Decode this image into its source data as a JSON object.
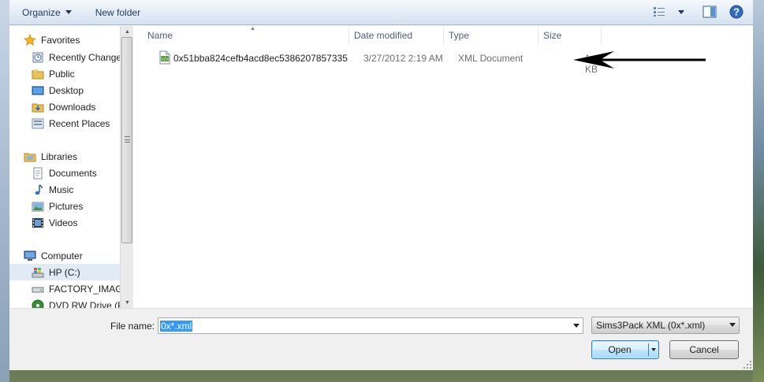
{
  "toolbar": {
    "organize_label": "Organize",
    "new_folder_label": "New folder",
    "icons": [
      "views-icon",
      "preview-pane-icon",
      "help-icon"
    ]
  },
  "nav": {
    "items": [
      {
        "label": "Favorites",
        "icon": "star-icon",
        "level": 1
      },
      {
        "label": "Recently Changed",
        "icon": "recent-icon",
        "level": 2
      },
      {
        "label": "Public",
        "icon": "folder-icon",
        "level": 2
      },
      {
        "label": "Desktop",
        "icon": "desktop-icon",
        "level": 2
      },
      {
        "label": "Downloads",
        "icon": "downloads-icon",
        "level": 2
      },
      {
        "label": "Recent Places",
        "icon": "recent-places-icon",
        "level": 2
      },
      {
        "label": "Libraries",
        "icon": "libraries-icon",
        "level": 1
      },
      {
        "label": "Documents",
        "icon": "documents-icon",
        "level": 2
      },
      {
        "label": "Music",
        "icon": "music-icon",
        "level": 2
      },
      {
        "label": "Pictures",
        "icon": "pictures-icon",
        "level": 2
      },
      {
        "label": "Videos",
        "icon": "videos-icon",
        "level": 2
      },
      {
        "label": "Computer",
        "icon": "computer-icon",
        "level": 1
      },
      {
        "label": "HP (C:)",
        "icon": "drive-icon",
        "level": 2,
        "selected": true
      },
      {
        "label": "FACTORY_IMAGE",
        "icon": "drive-icon",
        "level": 2
      },
      {
        "label": "DVD RW Drive (F:)",
        "icon": "dvd-icon",
        "level": 2
      }
    ]
  },
  "list": {
    "columns": [
      "Name",
      "Date modified",
      "Type",
      "Size"
    ],
    "files": [
      {
        "name": "0x51bba824cefb4acd8ec5386207857335",
        "date": "3/27/2012 2:19 AM",
        "type": "XML Document",
        "size": "1 KB",
        "icon": "xml-file-icon"
      }
    ]
  },
  "bottom": {
    "file_name_label": "File name:",
    "file_name_value": "0x*.xml",
    "filter_value": "Sims3Pack XML (0x*.xml)",
    "open_label": "Open",
    "cancel_label": "Cancel"
  }
}
